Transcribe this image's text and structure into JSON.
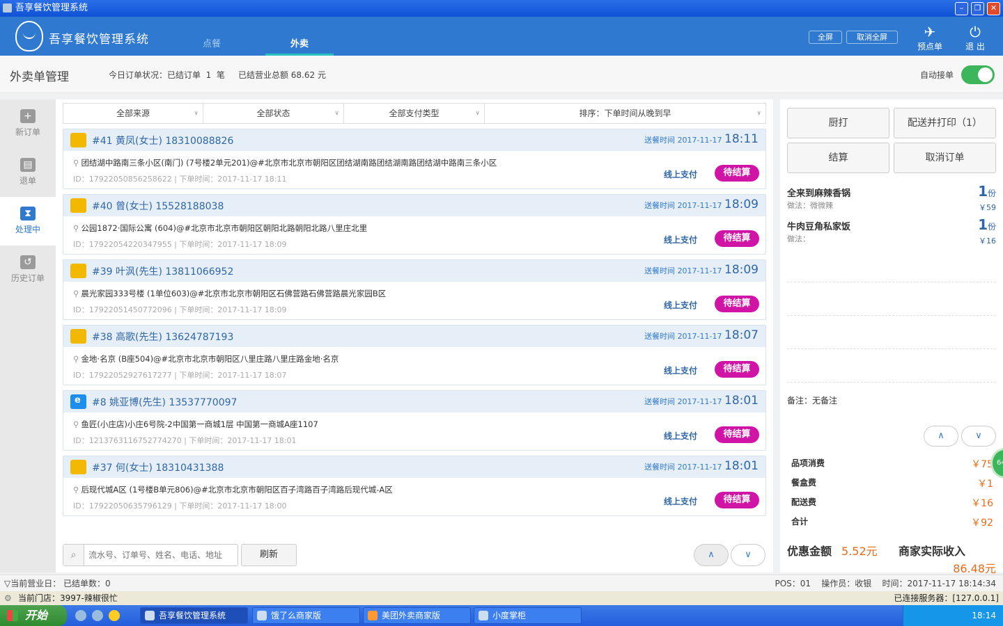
{
  "window": {
    "title": "吾享餐饮管理系统"
  },
  "header": {
    "brand": "吾享餐饮管理系统",
    "tabs": [
      "点餐",
      "外卖"
    ],
    "fullscreen": "全屏",
    "exit_fullscreen": "取消全屏",
    "preorder": "预点单",
    "logout": "退 出"
  },
  "subheader": {
    "title": "外卖单管理",
    "stats": "今日订单状况：已结订单  1  笔     已结营业总额 68.62 元",
    "auto_accept": "自动接单"
  },
  "sidebar": {
    "items": [
      "新订单",
      "退单",
      "处理中",
      "历史订单"
    ]
  },
  "filters": {
    "source": "全部来源",
    "status": "全部状态",
    "payment": "全部支付类型",
    "sort": "排序：下单时间从晚到早"
  },
  "orders": [
    {
      "title": "#41  黄凤(女士)  18310088826",
      "time_label": "送餐时间",
      "date": "2017-11-17",
      "time": "18:11",
      "address": "团结湖中路南三条小区(南门) (7号楼2单元201)@#北京市北京市朝阳区团结湖南路团结湖南路团结湖中路南三条小区",
      "meta": "ID：17922050856258622 | 下单时间：2017-11-17 18:11",
      "pay": "线上支付",
      "status": "待结算",
      "source": "meituan"
    },
    {
      "title": "#40  曾(女士)  15528188038",
      "time_label": "送餐时间",
      "date": "2017-11-17",
      "time": "18:09",
      "address": "公园1872·国际公寓 (604)@#北京市北京市朝阳区朝阳北路朝阳北路八里庄北里",
      "meta": "ID：17922054220347955 | 下单时间：2017-11-17 18:09",
      "pay": "线上支付",
      "status": "待结算",
      "source": "meituan"
    },
    {
      "title": "#39  叶沨(先生)  13811066952",
      "time_label": "送餐时间",
      "date": "2017-11-17",
      "time": "18:09",
      "address": "晨光家园333号楼 (1单位603)@#北京市北京市朝阳区石佛营路石佛营路晨光家园B区",
      "meta": "ID：17922051450772096 | 下单时间：2017-11-17 18:09",
      "pay": "线上支付",
      "status": "待结算",
      "source": "meituan"
    },
    {
      "title": "#38  高歌(先生)  13624787193",
      "time_label": "送餐时间",
      "date": "2017-11-17",
      "time": "18:07",
      "address": "金地·名京 (B座504)@#北京市北京市朝阳区八里庄路八里庄路金地·名京",
      "meta": "ID：17922052927617277 | 下单时间：2017-11-17 18:07",
      "pay": "线上支付",
      "status": "待结算",
      "source": "meituan"
    },
    {
      "title": "#8  姚亚博(先生)  13537770097",
      "time_label": "送餐时间",
      "date": "2017-11-17",
      "time": "18:01",
      "address": "鱼匠(小庄店)小庄6号院-2中国第一商城1层 中国第一商城A座1107",
      "meta": "ID：1213763116752774270 | 下单时间：2017-11-17 18:01",
      "pay": "线上支付",
      "status": "待结算",
      "source": "eleme"
    },
    {
      "title": "#37  何(女士)  18310431388",
      "time_label": "送餐时间",
      "date": "2017-11-17",
      "time": "18:01",
      "address": "后现代城A区 (1号楼B单元806)@#北京市北京市朝阳区百子湾路百子湾路后现代城-A区",
      "meta": "ID：17922050635796129 | 下单时间：2017-11-17 18:00",
      "pay": "线上支付",
      "status": "待结算",
      "source": "meituan"
    }
  ],
  "search": {
    "placeholder": "流水号、订单号、姓名、电话、地址",
    "refresh": "刷新",
    "up": "∧",
    "down": "∨"
  },
  "detail": {
    "buttons": [
      "厨打",
      "配送并打印（1）",
      "结算",
      "取消订单"
    ],
    "items": [
      {
        "name": "全来到麻辣香锅",
        "note": "做法：微微辣",
        "qty": "1",
        "unit": "份",
        "price": "￥59"
      },
      {
        "name": "牛肉豆角私家饭",
        "note": "做法：",
        "qty": "1",
        "unit": "份",
        "price": "￥16"
      }
    ],
    "remark": "备注：无备注",
    "fees": [
      {
        "label": "品项消费",
        "value": "￥75"
      },
      {
        "label": "餐盒费",
        "value": "￥1"
      },
      {
        "label": "配送费",
        "value": "￥16"
      },
      {
        "label": "合计",
        "value": "￥92"
      }
    ],
    "discount_label": "优惠金额",
    "discount_value": "5.52元",
    "income_label": "商家实际收入",
    "income_value": "86.48元",
    "handle_badge": "64"
  },
  "statusbar": {
    "left": "▽当前营业日：  已结单数：0",
    "right": "POS：01    操作员：收银    时间：2017-11-17 18:14:34"
  },
  "storebar": {
    "left": "当前门店：3997-辣椒很忙",
    "right": "已连接服务器：[127.0.0.1]"
  },
  "taskbar": {
    "start": "开始",
    "tasks": [
      "吾享餐饮管理系统",
      "饿了么商家版",
      "美团外卖商家版",
      "小度掌柜"
    ],
    "clock": "18:14"
  }
}
